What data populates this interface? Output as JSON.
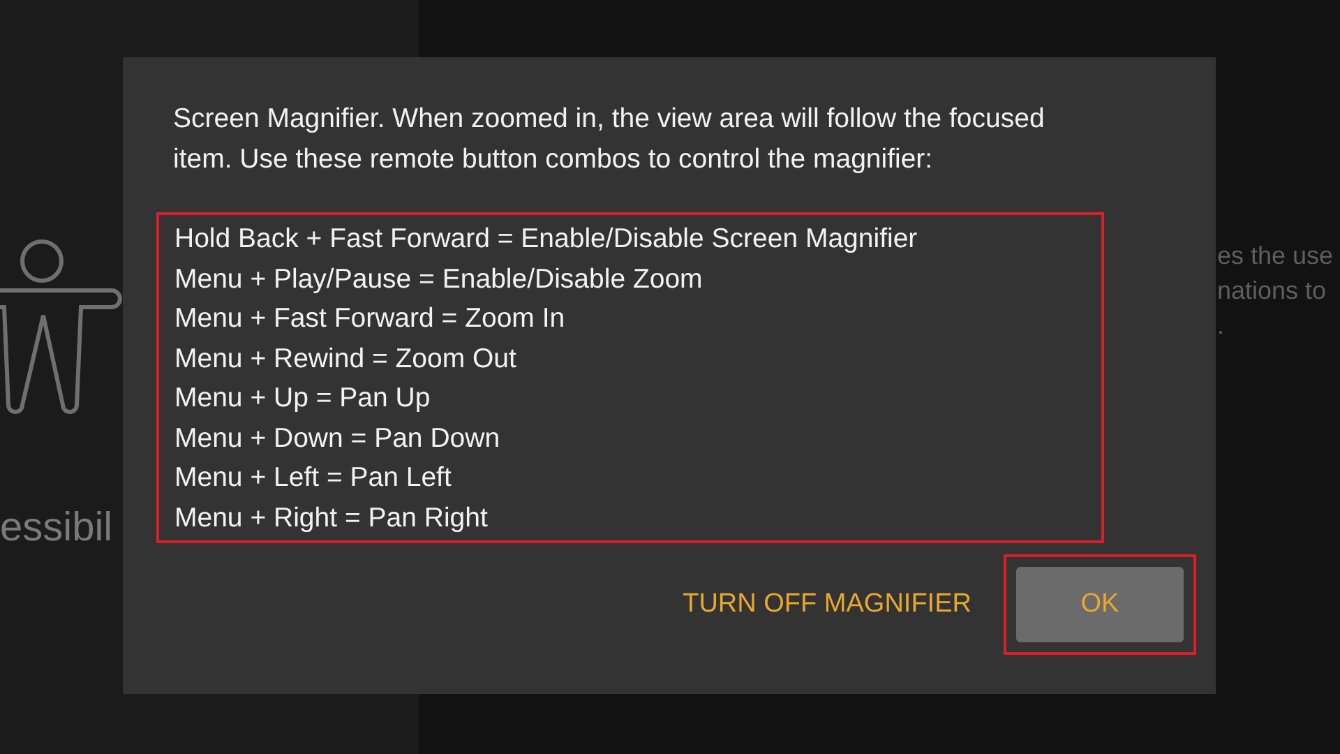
{
  "background": {
    "side_label": "essibil",
    "description_lines": [
      "es the use",
      "nations to",
      "."
    ]
  },
  "dialog": {
    "message": "Screen Magnifier. When zoomed in, the view area will follow the focused item. Use these remote button combos to control the magnifier:",
    "combos_highlighted": true,
    "combos": [
      "Hold Back + Fast Forward = Enable/Disable Screen Magnifier",
      "Menu + Play/Pause = Enable/Disable Zoom",
      "Menu + Fast Forward = Zoom In",
      "Menu + Rewind = Zoom Out",
      "Menu + Up = Pan Up",
      "Menu + Down = Pan Down",
      "Menu + Left = Pan Left",
      "Menu + Right = Pan Right"
    ],
    "buttons": [
      {
        "label": "TURN OFF MAGNIFIER",
        "kind": "text",
        "focused": false,
        "highlighted": false
      },
      {
        "label": "OK",
        "kind": "filled",
        "focused": true,
        "highlighted": true
      }
    ]
  }
}
